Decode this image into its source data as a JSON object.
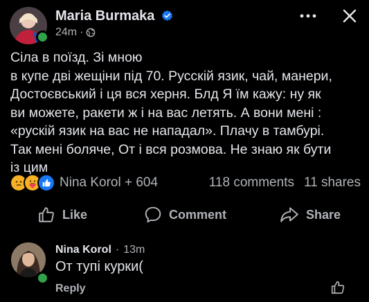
{
  "post": {
    "author": "Maria Burmaka",
    "time": "24m",
    "text": "Сіла в поїзд.  Зі мною\nв  купе дві жещіни під 70. Русскій язик, чай, манери,\nДостоєвський і ця вся  херня. Блд Я їм кажу: ну як\nви можете, ракети ж і на вас летять. А вони мені :\n«рускій язик на вас не нападал». Плачу в тамбурі.\nТак мені боляче, От і вся розмова. Не знаю як бути\nіз цим",
    "reactions_summary": "Nina Korol + 604",
    "comments_count": "118 comments",
    "shares_count": "11 shares"
  },
  "actions": {
    "like": "Like",
    "comment": "Comment",
    "share": "Share"
  },
  "comment": {
    "author": "Nina Korol",
    "time": "13m",
    "text": "От тупі курки(",
    "reply": "Reply"
  },
  "colors": {
    "background": "#000000",
    "text_primary": "#e4e6eb",
    "text_secondary": "#b0b3b8",
    "online": "#31a24c",
    "verified": "#1877f2"
  },
  "icons": {
    "more": "more-dots-icon",
    "close": "close-icon",
    "privacy": "globe-icon",
    "verified": "verified-badge-icon",
    "like": "thumbs-up-icon",
    "comment": "speech-bubble-icon",
    "share": "share-arrow-icon"
  }
}
